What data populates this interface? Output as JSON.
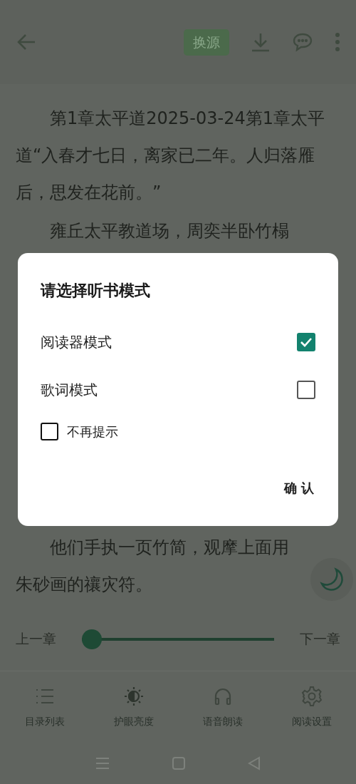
{
  "toolbar": {
    "source_button": "换源"
  },
  "paragraphs": [
    {
      "text": "第1章太平道2025-03-24第1章太平道“入春才七日，离家已二年。人归落雁后，思发在花前。”"
    },
    {
      "text": "雍丘太平教道场，周奕半卧竹榻"
    },
    {
      "text": "他们手执一页竹简，观摩上面用朱砂画的禳灾符。"
    }
  ],
  "dialog": {
    "title": "请选择听书模式",
    "options": [
      {
        "label": "阅读器模式",
        "checked": true
      },
      {
        "label": "歌词模式",
        "checked": false
      }
    ],
    "dont_remind": {
      "label": "不再提示",
      "checked": false
    },
    "confirm": "确 认"
  },
  "chapter_nav": {
    "previous": "上一章",
    "next": "下一章",
    "progress": {
      "level": 0
    }
  },
  "bottom_tabs": [
    {
      "label": "目录列表",
      "kind": "list"
    },
    {
      "label": "护眼亮度",
      "kind": "brightness"
    },
    {
      "label": "语音朗读",
      "kind": "headphones"
    },
    {
      "label": "阅读设置",
      "kind": "gear"
    }
  ]
}
